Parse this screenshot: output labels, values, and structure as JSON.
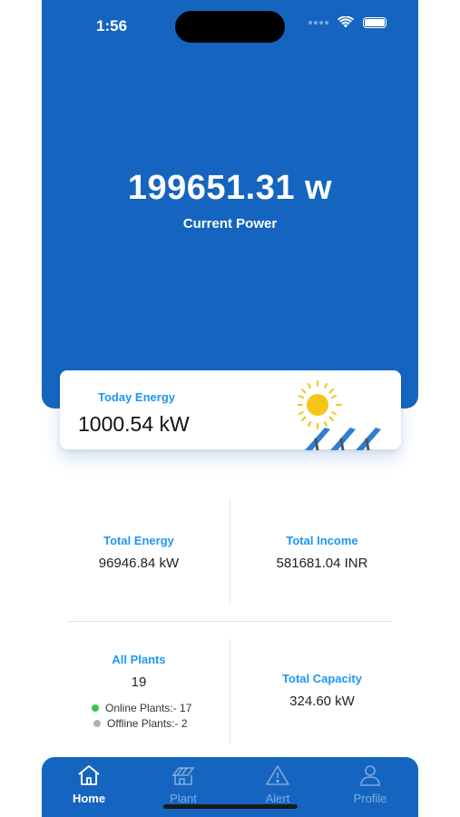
{
  "status_bar": {
    "time": "1:56"
  },
  "hero": {
    "power_value": "199651.31 w",
    "power_label": "Current Power"
  },
  "today": {
    "label": "Today Energy",
    "value": "1000.54 kW"
  },
  "stats": {
    "total_energy": {
      "label": "Total Energy",
      "value": "96946.84 kW"
    },
    "total_income": {
      "label": "Total Income",
      "value": "581681.04 INR"
    },
    "all_plants": {
      "label": "All Plants",
      "value": "19",
      "online": "Online Plants:- 17",
      "offline": "Offline Plants:- 2"
    },
    "total_capacity": {
      "label": "Total Capacity",
      "value": "324.60 kW"
    }
  },
  "tabs": [
    {
      "label": "Home",
      "icon": "home-icon",
      "active": true
    },
    {
      "label": "Plant",
      "icon": "plant-icon",
      "active": false
    },
    {
      "label": "Alert",
      "icon": "alert-icon",
      "active": false
    },
    {
      "label": "Profile",
      "icon": "profile-icon",
      "active": false
    }
  ],
  "colors": {
    "primary": "#1565c0",
    "accent": "#2196f3",
    "online": "#34c759",
    "offline": "#b0b0b0",
    "sun": "#f5c518"
  }
}
